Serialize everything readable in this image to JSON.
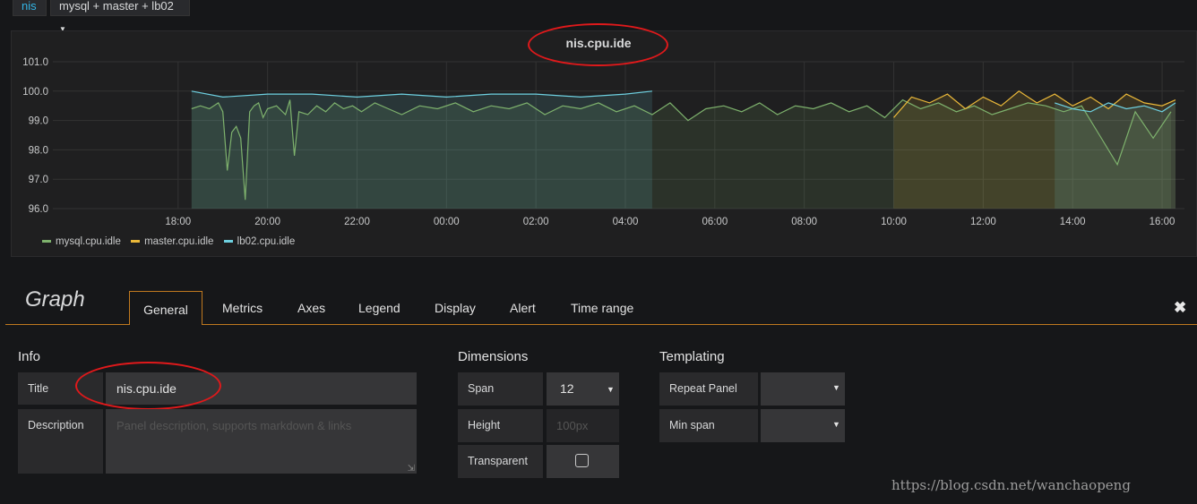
{
  "topbar": {
    "variable_label": "nis",
    "selector_value": "mysql + master + lb02"
  },
  "chart_data": {
    "type": "line",
    "title": "nis.cpu.ide",
    "ylim": [
      96.0,
      101.0
    ],
    "y_ticks": [
      "101.0",
      "100.0",
      "99.0",
      "98.0",
      "97.0",
      "96.0"
    ],
    "x_ticks": [
      "18:00",
      "20:00",
      "22:00",
      "00:00",
      "02:00",
      "04:00",
      "06:00",
      "08:00",
      "10:00",
      "12:00",
      "14:00",
      "16:00"
    ],
    "x_tick_hours": [
      18,
      20,
      22,
      24,
      26,
      28,
      30,
      32,
      34,
      36,
      38,
      40
    ],
    "x_range_hours": [
      15.2,
      40.5
    ],
    "series": [
      {
        "name": "mysql.cpu.idle",
        "color": "#7eb26d",
        "segments": [
          {
            "x": [
              18.3,
              18.5,
              18.7,
              18.9,
              19.0,
              19.1,
              19.2,
              19.3,
              19.4,
              19.5,
              19.6,
              19.7,
              19.8,
              19.9,
              20.0,
              20.2,
              20.4,
              20.5,
              20.6,
              20.7,
              20.9,
              21.1,
              21.3,
              21.5,
              21.7,
              21.9,
              22.1,
              22.4,
              22.7,
              23.0,
              23.4,
              23.8,
              24.2,
              24.6,
              25.0,
              25.4,
              25.8,
              26.2,
              26.6,
              27.0,
              27.4,
              27.8,
              28.2,
              28.6,
              29.0,
              29.4,
              29.8,
              30.2,
              30.6,
              31.0,
              31.4,
              31.8,
              32.2,
              32.6,
              33.0,
              33.4,
              33.8,
              34.2,
              34.6,
              35.0,
              35.4,
              35.8,
              36.2,
              36.6,
              37.0,
              37.4,
              37.8,
              38.2,
              38.6,
              39.0,
              39.4,
              39.8,
              40.2
            ],
            "y": [
              99.4,
              99.5,
              99.4,
              99.6,
              99.3,
              97.3,
              98.6,
              98.8,
              98.4,
              96.3,
              99.3,
              99.5,
              99.6,
              99.1,
              99.4,
              99.5,
              99.2,
              99.7,
              97.8,
              99.3,
              99.2,
              99.5,
              99.3,
              99.6,
              99.4,
              99.5,
              99.3,
              99.6,
              99.4,
              99.2,
              99.5,
              99.4,
              99.6,
              99.3,
              99.5,
              99.4,
              99.6,
              99.2,
              99.5,
              99.4,
              99.6,
              99.3,
              99.5,
              99.2,
              99.6,
              99.0,
              99.4,
              99.5,
              99.3,
              99.6,
              99.2,
              99.5,
              99.4,
              99.6,
              99.3,
              99.5,
              99.1,
              99.7,
              99.4,
              99.6,
              99.3,
              99.5,
              99.2,
              99.4,
              99.6,
              99.5,
              99.3,
              99.5,
              98.5,
              97.5,
              99.3,
              98.4,
              99.3
            ]
          }
        ]
      },
      {
        "name": "master.cpu.idle",
        "color": "#eab839",
        "segments": [
          {
            "x": [
              34.0,
              34.4,
              34.8,
              35.2,
              35.6,
              36.0,
              36.4,
              36.8,
              37.2,
              37.6,
              38.0,
              38.4,
              38.8,
              39.2,
              39.6,
              40.0,
              40.3
            ],
            "y": [
              99.1,
              99.8,
              99.6,
              99.9,
              99.4,
              99.8,
              99.5,
              100.0,
              99.6,
              99.9,
              99.5,
              99.8,
              99.4,
              99.9,
              99.6,
              99.5,
              99.7
            ]
          }
        ]
      },
      {
        "name": "lb02.cpu.idle",
        "color": "#6ed0e0",
        "segments": [
          {
            "x": [
              18.3,
              19.0,
              20.0,
              21.0,
              22.0,
              23.0,
              24.0,
              25.0,
              26.0,
              27.0,
              28.0,
              28.6
            ],
            "y": [
              100.0,
              99.8,
              99.9,
              99.9,
              99.8,
              99.9,
              99.8,
              99.9,
              99.9,
              99.8,
              99.9,
              100.0
            ]
          },
          {
            "x": [
              37.6,
              38.0,
              38.4,
              38.8,
              39.2,
              39.6,
              40.0,
              40.3
            ],
            "y": [
              99.6,
              99.4,
              99.3,
              99.6,
              99.4,
              99.5,
              99.3,
              99.6
            ]
          }
        ]
      }
    ]
  },
  "editor": {
    "panel_type": "Graph",
    "tabs": [
      "General",
      "Metrics",
      "Axes",
      "Legend",
      "Display",
      "Alert",
      "Time range"
    ],
    "close_icon": "close-icon"
  },
  "info": {
    "heading": "Info",
    "title_label": "Title",
    "title_value": "nis.cpu.ide",
    "description_label": "Description",
    "description_placeholder": "Panel description, supports markdown & links"
  },
  "dimensions": {
    "heading": "Dimensions",
    "span_label": "Span",
    "span_value": "12",
    "height_label": "Height",
    "height_placeholder": "100px",
    "transparent_label": "Transparent"
  },
  "templating": {
    "heading": "Templating",
    "repeat_label": "Repeat Panel",
    "min_span_label": "Min span"
  },
  "watermark": "https://blog.csdn.net/wanchaopeng"
}
